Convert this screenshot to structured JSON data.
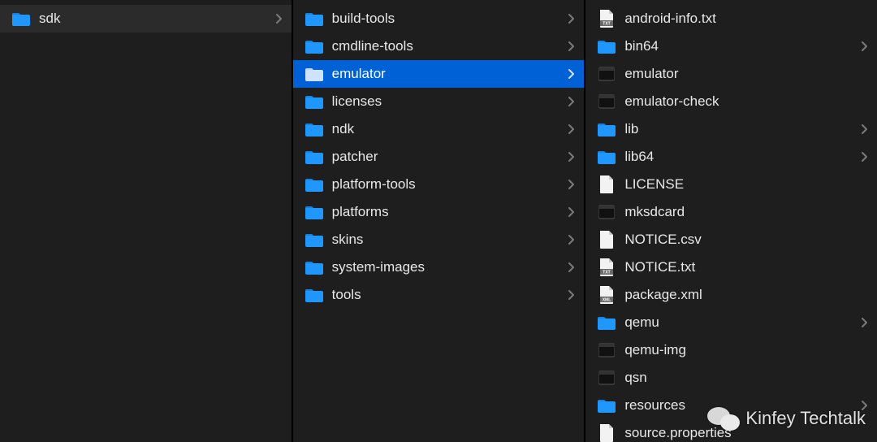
{
  "columns": [
    {
      "name": "column-1",
      "items": [
        {
          "name": "sdk",
          "type": "folder",
          "has_children": true,
          "state": "dim"
        }
      ]
    },
    {
      "name": "column-2",
      "items": [
        {
          "name": "build-tools",
          "type": "folder",
          "has_children": true,
          "state": ""
        },
        {
          "name": "cmdline-tools",
          "type": "folder",
          "has_children": true,
          "state": ""
        },
        {
          "name": "emulator",
          "type": "folder",
          "has_children": true,
          "state": "selected"
        },
        {
          "name": "licenses",
          "type": "folder",
          "has_children": true,
          "state": ""
        },
        {
          "name": "ndk",
          "type": "folder",
          "has_children": true,
          "state": ""
        },
        {
          "name": "patcher",
          "type": "folder",
          "has_children": true,
          "state": ""
        },
        {
          "name": "platform-tools",
          "type": "folder",
          "has_children": true,
          "state": ""
        },
        {
          "name": "platforms",
          "type": "folder",
          "has_children": true,
          "state": ""
        },
        {
          "name": "skins",
          "type": "folder",
          "has_children": true,
          "state": ""
        },
        {
          "name": "system-images",
          "type": "folder",
          "has_children": true,
          "state": ""
        },
        {
          "name": "tools",
          "type": "folder",
          "has_children": true,
          "state": ""
        }
      ]
    },
    {
      "name": "column-3",
      "items": [
        {
          "name": "android-info.txt",
          "type": "file-txt",
          "has_children": false,
          "state": ""
        },
        {
          "name": "bin64",
          "type": "folder",
          "has_children": true,
          "state": ""
        },
        {
          "name": "emulator",
          "type": "exec",
          "has_children": false,
          "state": ""
        },
        {
          "name": "emulator-check",
          "type": "exec",
          "has_children": false,
          "state": ""
        },
        {
          "name": "lib",
          "type": "folder",
          "has_children": true,
          "state": ""
        },
        {
          "name": "lib64",
          "type": "folder",
          "has_children": true,
          "state": ""
        },
        {
          "name": "LICENSE",
          "type": "file",
          "has_children": false,
          "state": ""
        },
        {
          "name": "mksdcard",
          "type": "exec",
          "has_children": false,
          "state": ""
        },
        {
          "name": "NOTICE.csv",
          "type": "file",
          "has_children": false,
          "state": ""
        },
        {
          "name": "NOTICE.txt",
          "type": "file-txt",
          "has_children": false,
          "state": ""
        },
        {
          "name": "package.xml",
          "type": "file-xml",
          "has_children": false,
          "state": ""
        },
        {
          "name": "qemu",
          "type": "folder",
          "has_children": true,
          "state": ""
        },
        {
          "name": "qemu-img",
          "type": "exec",
          "has_children": false,
          "state": ""
        },
        {
          "name": "qsn",
          "type": "exec",
          "has_children": false,
          "state": ""
        },
        {
          "name": "resources",
          "type": "folder",
          "has_children": true,
          "state": ""
        },
        {
          "name": "source.properties",
          "type": "file",
          "has_children": false,
          "state": ""
        }
      ]
    }
  ],
  "watermark": "Kinfey Techtalk"
}
